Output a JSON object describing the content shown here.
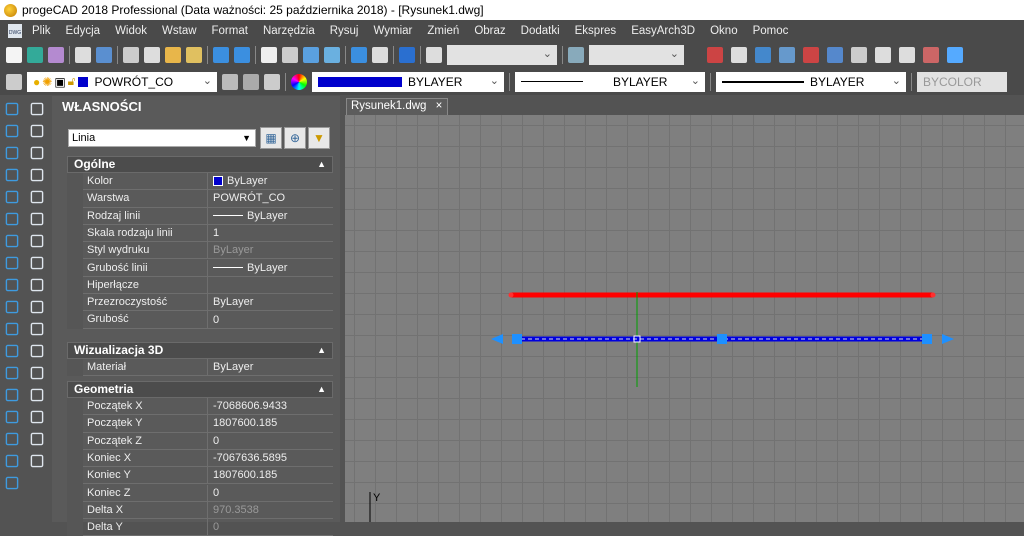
{
  "window": {
    "title": "progeCAD 2018 Professional  (Data ważności: 25 października 2018) - [Rysunek1.dwg]"
  },
  "menu": [
    "Plik",
    "Edycja",
    "Widok",
    "Wstaw",
    "Format",
    "Narzędzia",
    "Rysuj",
    "Wymiar",
    "Zmień",
    "Obraz",
    "Dodatki",
    "Ekspres",
    "EasyArch3D",
    "Okno",
    "Pomoc"
  ],
  "toolbar": {
    "layer": "POWRÓT_CO",
    "color": "BYLAYER",
    "linetype": "BYLAYER",
    "lineweight": "BYLAYER",
    "plotstyle": "BYCOLOR",
    "layer_color": "#0000cc"
  },
  "panel": {
    "title": "WŁASNOŚCI",
    "object_type": "Linia",
    "sections": [
      {
        "name": "Ogólne",
        "rows": [
          {
            "k": "Kolor",
            "v": "ByLayer",
            "swatch": true
          },
          {
            "k": "Warstwa",
            "v": "POWRÓT_CO"
          },
          {
            "k": "Rodzaj linii",
            "v": "ByLayer",
            "line": true
          },
          {
            "k": "Skala rodzaju linii",
            "v": "1"
          },
          {
            "k": "Styl wydruku",
            "v": "ByLayer",
            "dim": true
          },
          {
            "k": "Grubość linii",
            "v": "ByLayer",
            "line": true
          },
          {
            "k": "Hiperłącze",
            "v": ""
          },
          {
            "k": "Przezroczystość",
            "v": "ByLayer"
          },
          {
            "k": "Grubość",
            "v": "0"
          }
        ]
      },
      {
        "name": "Wizualizacja 3D",
        "rows": [
          {
            "k": "Materiał",
            "v": "ByLayer"
          }
        ]
      },
      {
        "name": "Geometria",
        "rows": [
          {
            "k": "Początek X",
            "v": "-7068606.9433"
          },
          {
            "k": "Początek Y",
            "v": "1807600.185"
          },
          {
            "k": "Początek Z",
            "v": "0"
          },
          {
            "k": "Koniec X",
            "v": "-7067636.5895"
          },
          {
            "k": "Koniec Y",
            "v": "1807600.185"
          },
          {
            "k": "Koniec Z",
            "v": "0"
          },
          {
            "k": "Delta X",
            "v": "970.3538",
            "dim": true
          },
          {
            "k": "Delta Y",
            "v": "0",
            "dim": true
          }
        ]
      }
    ]
  },
  "document": {
    "tab": "Rysunek1.dwg",
    "close": "×",
    "ucs_y": "Y"
  },
  "colors": {
    "red_line": "#ff0000",
    "selected_line": "#0000e0",
    "grip": "#1e90ff",
    "crosshair": "#00a000"
  }
}
